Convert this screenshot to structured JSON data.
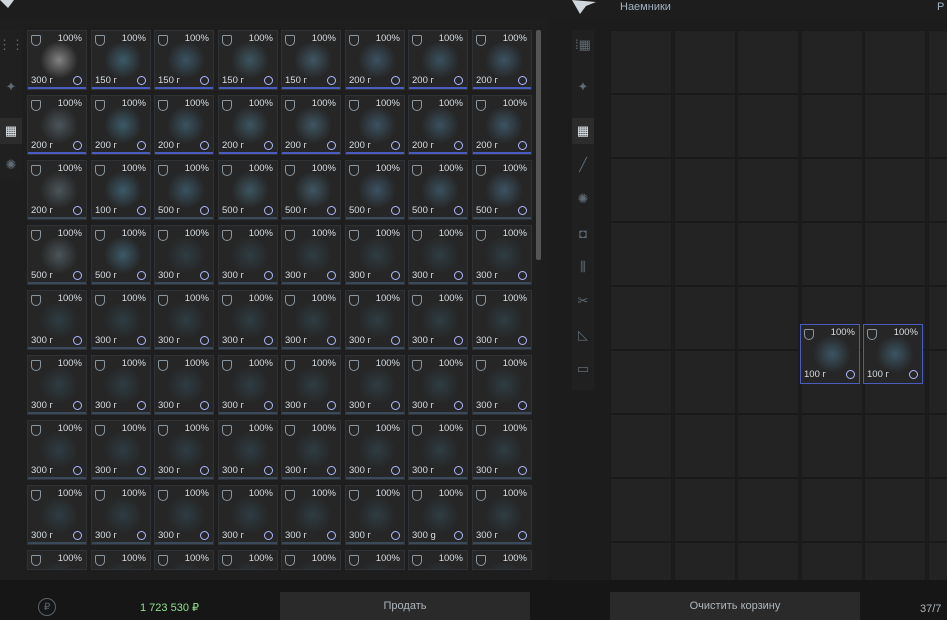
{
  "header": {
    "right_title": "Наемники",
    "right_edge_text": "Р"
  },
  "left_sidebar": {
    "icons": [
      "grid-small-icon",
      "star-icon",
      "grid-icon",
      "badge-icon"
    ]
  },
  "right_sidebar": {
    "icons": [
      "slots-icon",
      "star-icon",
      "grid-icon",
      "rifle-icon",
      "badge-icon",
      "camera-icon",
      "bars-icon",
      "tools-icon",
      "blueprint-icon",
      "crate-icon"
    ]
  },
  "inventory": {
    "percent": "100%",
    "rows": [
      [
        "300 г",
        "150 г",
        "150 г",
        "150 г",
        "150 г",
        "200 г",
        "200 г",
        "200 г"
      ],
      [
        "200 г",
        "200 г",
        "200 г",
        "200 г",
        "200 г",
        "200 г",
        "200 г",
        "200 г"
      ],
      [
        "200 г",
        "100 г",
        "500 г",
        "500 г",
        "500 г",
        "500 г",
        "500 г",
        "500 г"
      ],
      [
        "500 г",
        "500 г",
        "300 г",
        "300 г",
        "300 г",
        "300 г",
        "300 г",
        "300 г"
      ],
      [
        "300 г",
        "300 г",
        "300 г",
        "300 г",
        "300 г",
        "300 г",
        "300 г",
        "300 г"
      ],
      [
        "300 г",
        "300 г",
        "300 г",
        "300 г",
        "300 г",
        "300 г",
        "300 г",
        "300 г"
      ],
      [
        "300 г",
        "300 г",
        "300 г",
        "300 г",
        "300 г",
        "300 г",
        "300 г",
        "300 г"
      ],
      [
        "300 г",
        "300 г",
        "300 г",
        "300 г",
        "300 г",
        "300 г",
        "300 g",
        "300 г"
      ],
      [
        "",
        "",
        "",
        "",
        "",
        "",
        "",
        ""
      ]
    ]
  },
  "cart": {
    "items": [
      {
        "percent": "100%",
        "price": "100 г"
      },
      {
        "percent": "100%",
        "price": "100 г"
      }
    ]
  },
  "footer": {
    "balance": "1 723 530 ₽",
    "sell_label": "Продать",
    "clear_label": "Очистить корзину",
    "count": "37/7"
  }
}
